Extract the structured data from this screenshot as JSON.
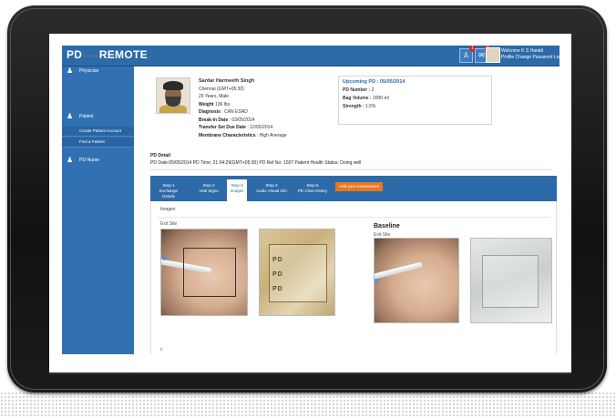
{
  "app": {
    "logo_left": "PD",
    "logo_sep": "·····",
    "logo_right": "REMOTE"
  },
  "topbar": {
    "icons": [
      {
        "name": "user-alert-icon",
        "badge": "1"
      },
      {
        "name": "message-icon",
        "badge": "1"
      }
    ],
    "welcome": "Welcome K S Harald",
    "links": "Profile  Change Password  Logout"
  },
  "sidebar": {
    "items": [
      {
        "label": "Physician",
        "icon": "physician-icon"
      },
      {
        "label": "Patient",
        "icon": "patient-icon"
      },
      {
        "label": "PD-Nurse",
        "icon": "nurse-icon"
      }
    ],
    "patient_sub": [
      "Create Patient Account",
      "Find a Patient"
    ]
  },
  "patient": {
    "name": "Sardar Harmeeth Singh",
    "timezone": "Chennai (GMT+05:30)",
    "age_sex": "29 Years, Male",
    "weight_label": "Weight",
    "weight": "136 lbs",
    "diagnosis_label": "Diagnosis",
    "diagnosis": "CAN ESRD",
    "breakin_label": "Break-in Date",
    "breakin": "03/05/2014",
    "transfer_label": "Transfer Set Due Date",
    "transfer": "12/05/2014",
    "membrane_label": "Membrane Characteristics",
    "membrane": "High Average"
  },
  "upcoming": {
    "title": "Upcoming PD : 05/05/2014",
    "pd_number_label": "PD Number :",
    "pd_number": "2",
    "bag_volume_label": "Bag Volume :",
    "bag_volume": "2000 ml",
    "strength_label": "Strength :",
    "strength": "1.5%"
  },
  "pd_detail": {
    "heading": "PD Detail",
    "line": "PD Date:05/05/2014 PD Time: 21:04:29(GMT+05:30) PD Ref No: 1507 Patient Health Status: Doing well"
  },
  "tabs": [
    {
      "line1": "Step-1",
      "line2": "Exchange Details",
      "active": false
    },
    {
      "line1": "Step-2",
      "line2": "Vital Signs",
      "active": false
    },
    {
      "line1": "Step-3",
      "line2": "Images",
      "active": true
    },
    {
      "line1": "Step-4",
      "line2": "Audio Visual Info",
      "active": false
    },
    {
      "line1": "Step-5",
      "line2": "PD Chat History",
      "active": false
    }
  ],
  "assessment_button": "Add your Assessment",
  "images": {
    "section_label": "Images",
    "exit_site_label": "Exit Site",
    "baseline_label": "Baseline",
    "baseline_exit_label": "Exit Site",
    "bag_text": "PD"
  },
  "colors": {
    "primary": "#2c6aa8",
    "sidebar": "#3171b2",
    "accent": "#e87722",
    "badge": "#d9222a"
  }
}
